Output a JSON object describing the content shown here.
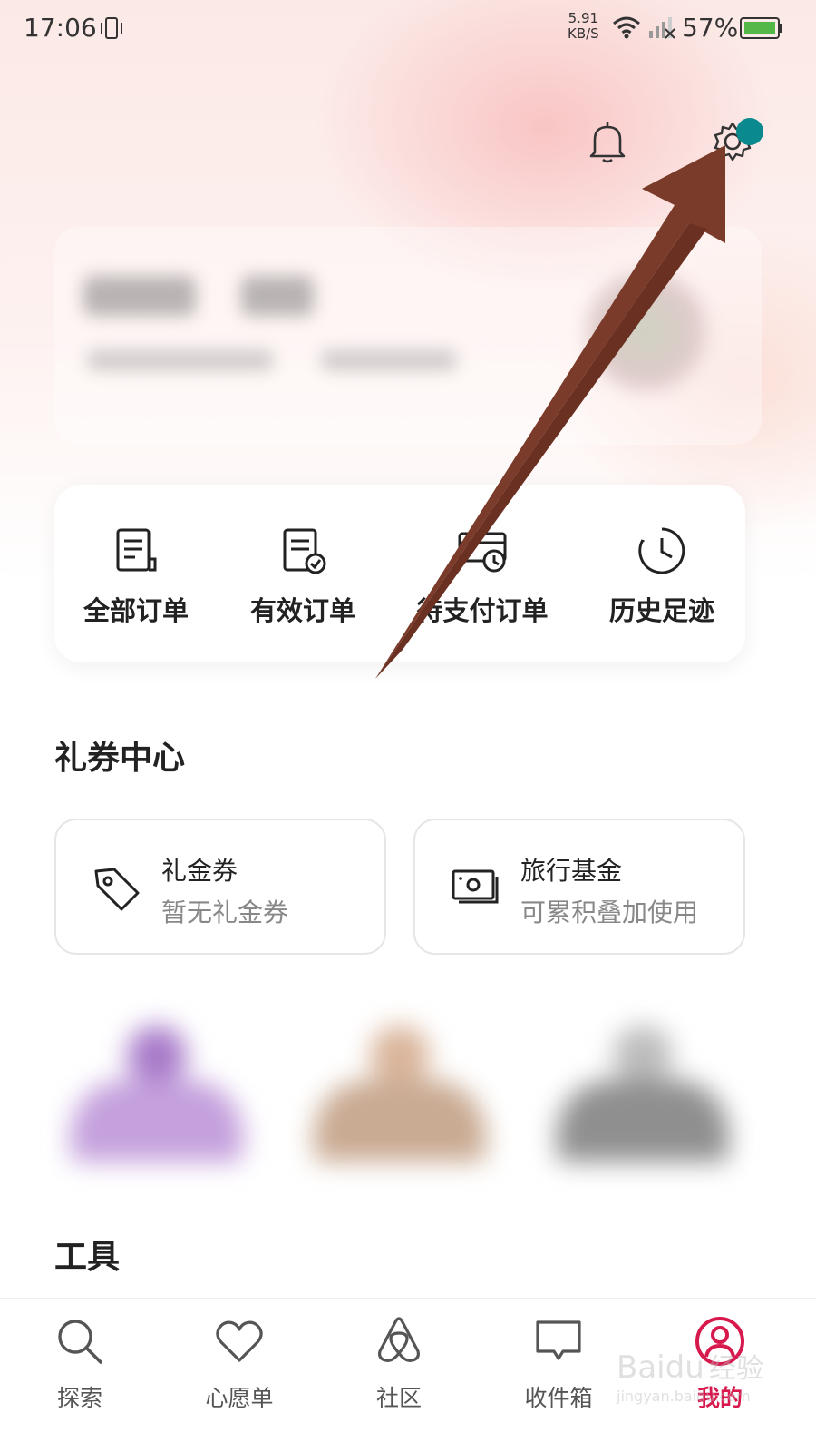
{
  "status_bar": {
    "time": "17:06",
    "net_speed_value": "5.91",
    "net_speed_unit": "KB/S",
    "battery": "57%"
  },
  "header": {
    "icons": [
      "bell-icon",
      "gear-icon"
    ],
    "notification_dot_color": "#0a8a8f"
  },
  "orders": [
    {
      "label": "全部订单",
      "icon": "document-icon"
    },
    {
      "label": "有效订单",
      "icon": "document-check-icon"
    },
    {
      "label": "待支付订单",
      "icon": "ticket-clock-icon"
    },
    {
      "label": "历史足迹",
      "icon": "history-clock-icon"
    }
  ],
  "coupons": {
    "title": "礼券中心",
    "items": [
      {
        "title": "礼金券",
        "subtitle": "暂无礼金券",
        "icon": "tag-icon"
      },
      {
        "title": "旅行基金",
        "subtitle": "可累积叠加使用",
        "icon": "cash-icon"
      }
    ]
  },
  "tools": {
    "title": "工具"
  },
  "nav": {
    "items": [
      {
        "label": "探索",
        "icon": "search-icon",
        "active": false
      },
      {
        "label": "心愿单",
        "icon": "heart-icon",
        "active": false
      },
      {
        "label": "社区",
        "icon": "airbnb-logo-icon",
        "active": false
      },
      {
        "label": "收件箱",
        "icon": "message-icon",
        "active": false
      },
      {
        "label": "我的",
        "icon": "profile-icon",
        "active": true
      }
    ],
    "active_color": "#d7194e"
  },
  "annotation": {
    "arrow_color": "#7b3b2a"
  }
}
